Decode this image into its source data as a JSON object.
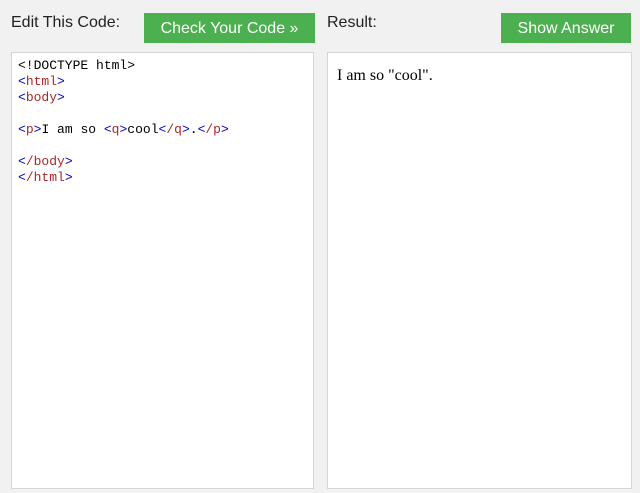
{
  "header": {
    "edit_label": "Edit This Code:",
    "check_button": "Check Your Code »",
    "result_label": "Result:",
    "answer_button": "Show Answer"
  },
  "editor": {
    "line1": "<!DOCTYPE html>",
    "line2_tag": "html",
    "line3_tag": "body",
    "line5_p": "p",
    "line5_text1": "I am so ",
    "line5_q": "q",
    "line5_text2": "cool",
    "line5_q_close": "/q",
    "line5_text3": ".",
    "line5_p_close": "/p",
    "line7_tag": "/body",
    "line8_tag": "/html"
  },
  "result": {
    "text": "I am so \"cool\"."
  }
}
